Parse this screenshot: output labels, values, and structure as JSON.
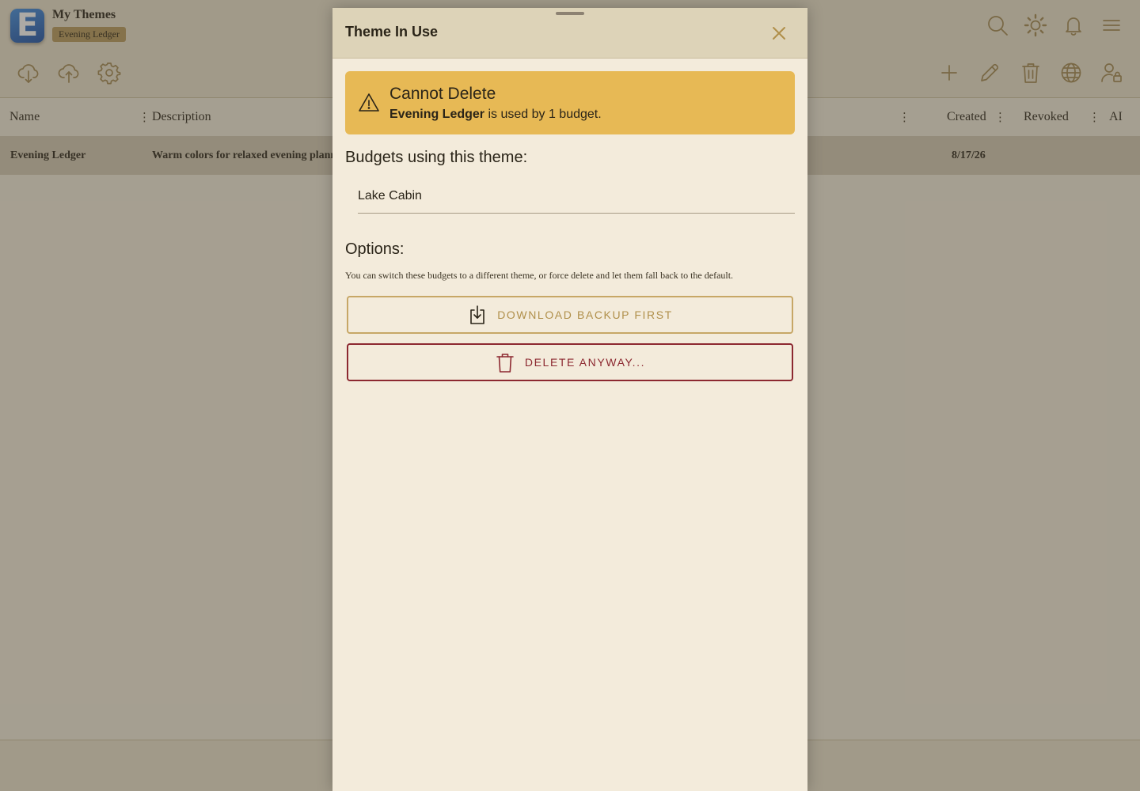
{
  "app": {
    "title": "My Themes",
    "badge": "Evening Ledger",
    "logo_letter": "E"
  },
  "toolbar_left": [
    "cloud-download-icon",
    "cloud-upload-icon",
    "gear-icon"
  ],
  "toolbar_right": [
    "plus-icon",
    "pencil-icon",
    "trash-icon",
    "globe-icon",
    "user-lock-icon"
  ],
  "header_right": [
    "search-icon",
    "sun-icon",
    "bell-icon",
    "menu-icon"
  ],
  "table": {
    "columns": {
      "name": "Name",
      "description": "Description",
      "created": "Created",
      "revoked": "Revoked",
      "ai": "AI"
    },
    "column_menu_glyph": "⋮",
    "rows": [
      {
        "name": "Evening Ledger",
        "description": "Warm colors for relaxed evening planning",
        "created": "8/17/26",
        "revoked": "",
        "ai": ""
      }
    ]
  },
  "modal": {
    "title": "Theme In Use",
    "alert": {
      "title": "Cannot Delete",
      "theme_name": "Evening Ledger",
      "message_suffix": " is used by 1 budget."
    },
    "budgets_heading": "Budgets using this theme:",
    "budgets": [
      "Lake Cabin"
    ],
    "options_heading": "Options:",
    "options_hint": "You can switch these budgets to a different theme, or force delete and let them fall back to the default.",
    "backup_button": "DOWNLOAD BACKUP FIRST",
    "delete_button": "DELETE ANYWAY..."
  },
  "colors": {
    "background": "#f3ebdb",
    "header": "#ece2cc",
    "accent_gold": "#b08f4a",
    "warning": "#e7b955",
    "danger": "#8c2830"
  }
}
